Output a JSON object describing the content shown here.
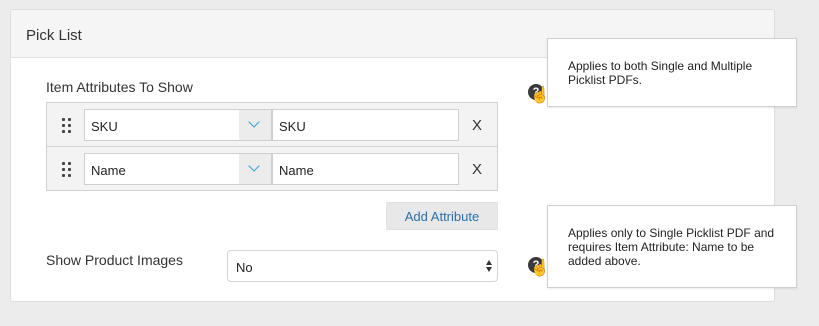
{
  "panel": {
    "title": "Pick List"
  },
  "attributes": {
    "label": "Item Attributes To Show",
    "rows": [
      {
        "selected": "SKU",
        "value": "SKU",
        "remove": "X"
      },
      {
        "selected": "Name",
        "value": "Name",
        "remove": "X"
      }
    ],
    "add_label": "Add Attribute"
  },
  "images": {
    "label": "Show Product Images",
    "selected": "No"
  },
  "help": {
    "icon_text": "?",
    "tooltip_attributes": "Applies to both Single and Multiple Picklist PDFs.",
    "tooltip_images": "Applies only to Single Picklist PDF and requires Item Attribute: Name to be added above."
  },
  "cursor_glyph": "☝",
  "colors": {
    "accent": "#2a9fd8",
    "link": "#2d6fa6"
  }
}
